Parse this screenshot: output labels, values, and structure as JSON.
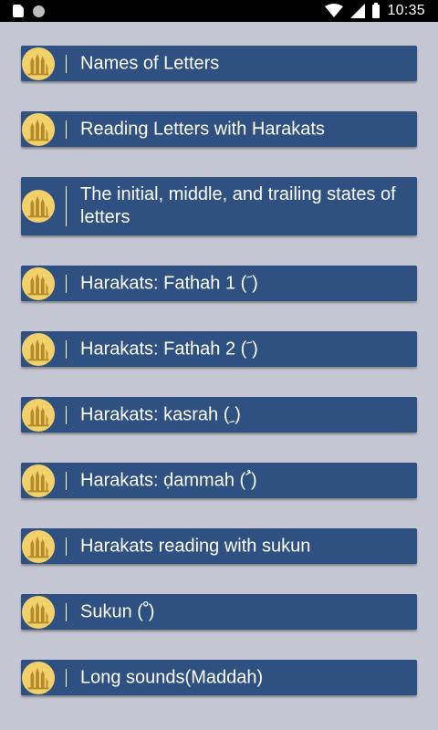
{
  "status_bar": {
    "time": "10:35",
    "icons": [
      "sim-card-icon",
      "notification-dot-icon",
      "wifi-icon",
      "signal-icon",
      "battery-icon"
    ]
  },
  "menu": {
    "items": [
      {
        "label": "Names of Letters",
        "icon": "mosque-logo-icon"
      },
      {
        "label": "Reading Letters with Harakats",
        "icon": "mosque-logo-icon"
      },
      {
        "label": "The initial, middle, and trailing states of letters",
        "icon": "mosque-logo-icon"
      },
      {
        "label": "Harakats: Fathah 1 ( َ)",
        "icon": "mosque-logo-icon"
      },
      {
        "label": "Harakats: Fathah 2 ( َ)",
        "icon": "mosque-logo-icon"
      },
      {
        "label": "Harakats: kasrah ( ِ)",
        "icon": "mosque-logo-icon"
      },
      {
        "label": "Harakats: ḍammah ( ُ)",
        "icon": "mosque-logo-icon"
      },
      {
        "label": "Harakats reading with sukun",
        "icon": "mosque-logo-icon"
      },
      {
        "label": "Sukun ( ْ)",
        "icon": "mosque-logo-icon"
      },
      {
        "label": "Long sounds(Maddah)",
        "icon": "mosque-logo-icon"
      }
    ]
  },
  "colors": {
    "background": "#c5c6d3",
    "item_background": "#2e5182",
    "logo_gold": "#f2d16b",
    "status_bar": "#000000"
  }
}
